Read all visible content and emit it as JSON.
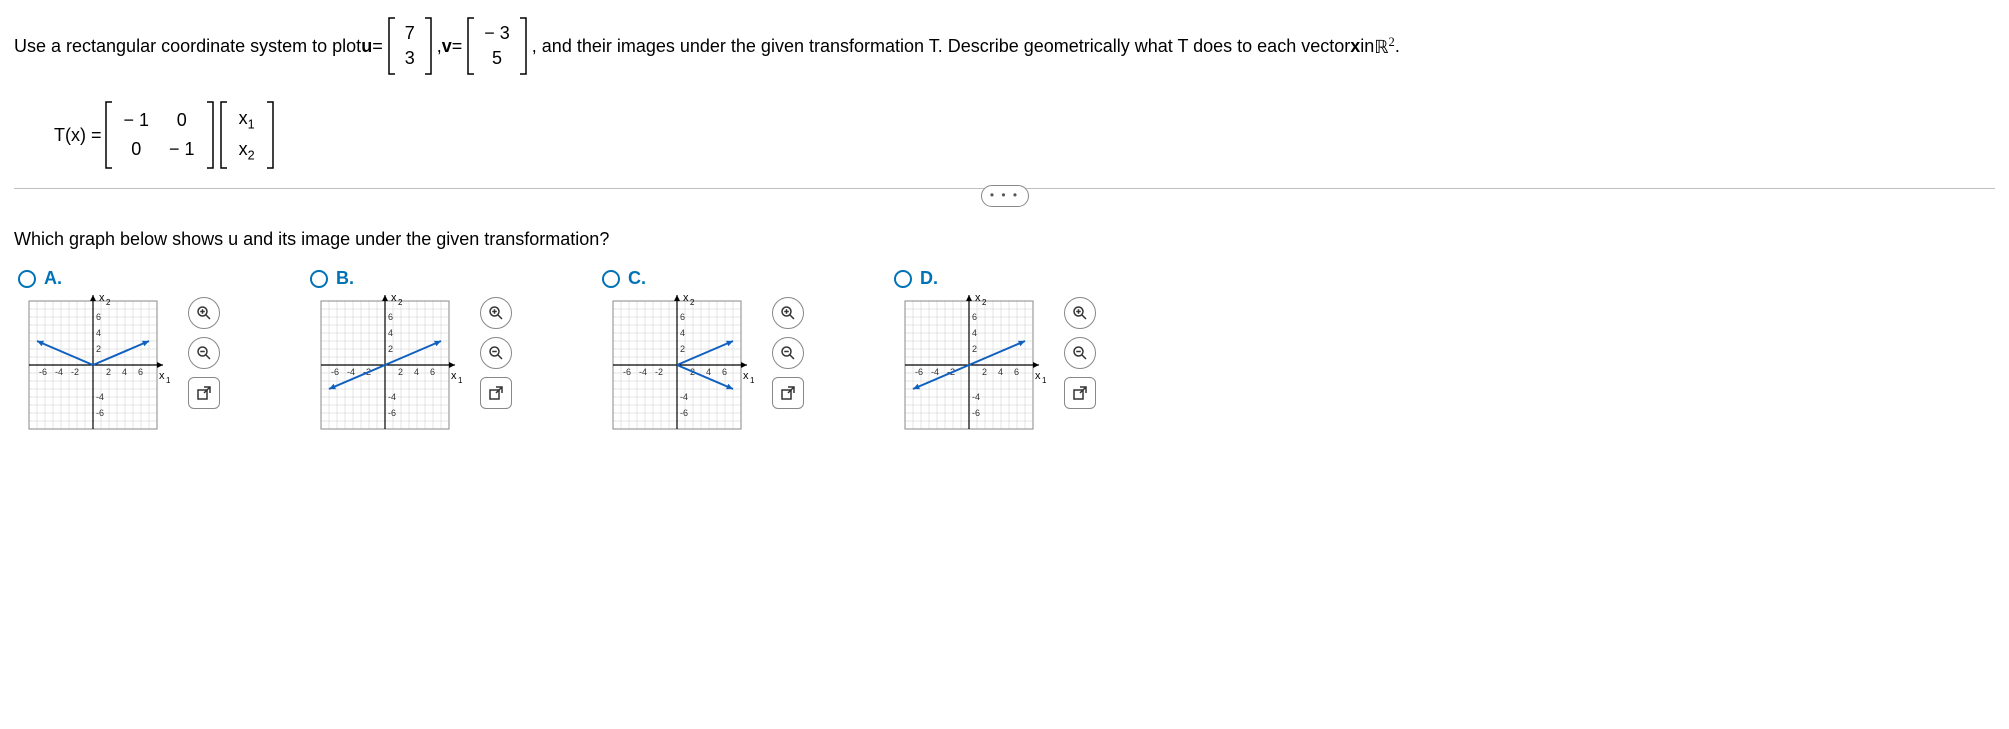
{
  "problem": {
    "text1": "Use a rectangular coordinate system to plot ",
    "u_label": "u",
    "equals1": " = ",
    "u_vec": [
      "7",
      "3"
    ],
    "comma_v": ", ",
    "v_label": "v",
    "equals2": " = ",
    "v_vec": [
      "− 3",
      "5"
    ],
    "text2": ", and their images under the given transformation T. Describe geometrically what T does to each vector ",
    "x_label": "x",
    "text3": " in ",
    "r2": "ℝ",
    "r2_sup": "2",
    "period": "."
  },
  "tx": {
    "label": "T(x) = ",
    "matrix": [
      [
        "− 1",
        "0"
      ],
      [
        "0",
        "− 1"
      ]
    ],
    "xvec": [
      "x",
      "x"
    ],
    "xvec_sub": [
      "1",
      "2"
    ]
  },
  "question": "Which graph below shows u and its image under the given transformation?",
  "options": {
    "a": "A.",
    "b": "B.",
    "c": "C.",
    "d": "D."
  },
  "axis": {
    "y_label": "x",
    "y_sub": "2",
    "x_label": "x",
    "x_sub": "1",
    "ticks_pos": [
      "2",
      "4",
      "6"
    ],
    "ticks_neg": [
      "-6",
      "-4",
      "-2"
    ],
    "yticks_pos": [
      "6",
      "4",
      "2"
    ],
    "yticks_neg": [
      "-4",
      "-6"
    ]
  },
  "graph_vectors": {
    "a": {
      "u": [
        7,
        3
      ],
      "t": [
        -7,
        3
      ]
    },
    "b": {
      "u": [
        7,
        3
      ],
      "t": [
        -7,
        -3
      ]
    },
    "c": {
      "u": [
        7,
        3
      ],
      "t": [
        7,
        -3
      ]
    },
    "d": {
      "u": [
        7,
        3
      ],
      "t": [
        -7,
        -3
      ]
    }
  },
  "dots": "• • •"
}
